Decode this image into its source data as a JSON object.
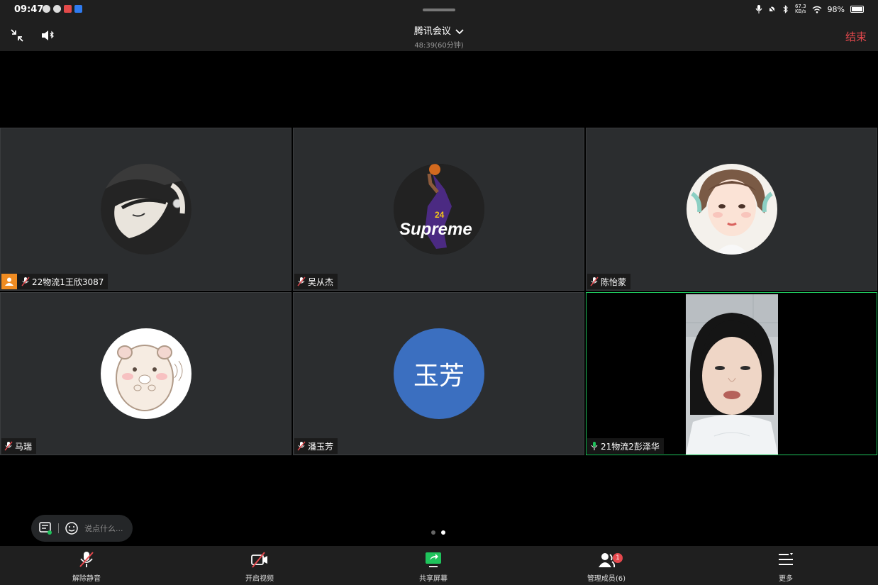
{
  "status_bar": {
    "time": "09:47",
    "net_speed_value": "67.3",
    "net_speed_unit": "KB/s",
    "battery": "98%"
  },
  "header": {
    "title": "腾讯会议",
    "timer": "48:39(60分钟)",
    "end_label": "结束"
  },
  "participants": [
    {
      "name": "22物流1王欣3087",
      "host": true,
      "mic": "muted"
    },
    {
      "name": "吴从杰",
      "host": false,
      "mic": "muted"
    },
    {
      "name": "陈怡蒙",
      "host": false,
      "mic": "muted"
    },
    {
      "name": "马瑞",
      "host": false,
      "mic": "muted"
    },
    {
      "name": "潘玉芳",
      "host": false,
      "mic": "muted",
      "avatar_text": "玉芳"
    },
    {
      "name": "21物流2彭泽华",
      "host": false,
      "mic": "on",
      "video": true
    }
  ],
  "avatar_texts": {
    "supreme_logo": "Supreme",
    "jersey_number": "24"
  },
  "chat": {
    "placeholder": "说点什么..."
  },
  "pagination": {
    "total": 2,
    "current": 2
  },
  "toolbar": {
    "unmute": "解除静音",
    "start_video": "开启视频",
    "share_screen": "共享屏幕",
    "manage_members": "管理成员(6)",
    "manage_badge": "1",
    "more": "更多"
  },
  "colors": {
    "end_red": "#e5484d",
    "active_speaker": "#1fc45c",
    "host_badge": "#f08c22",
    "initials_avatar": "#3b6fc0",
    "share_green": "#1fc45c"
  }
}
